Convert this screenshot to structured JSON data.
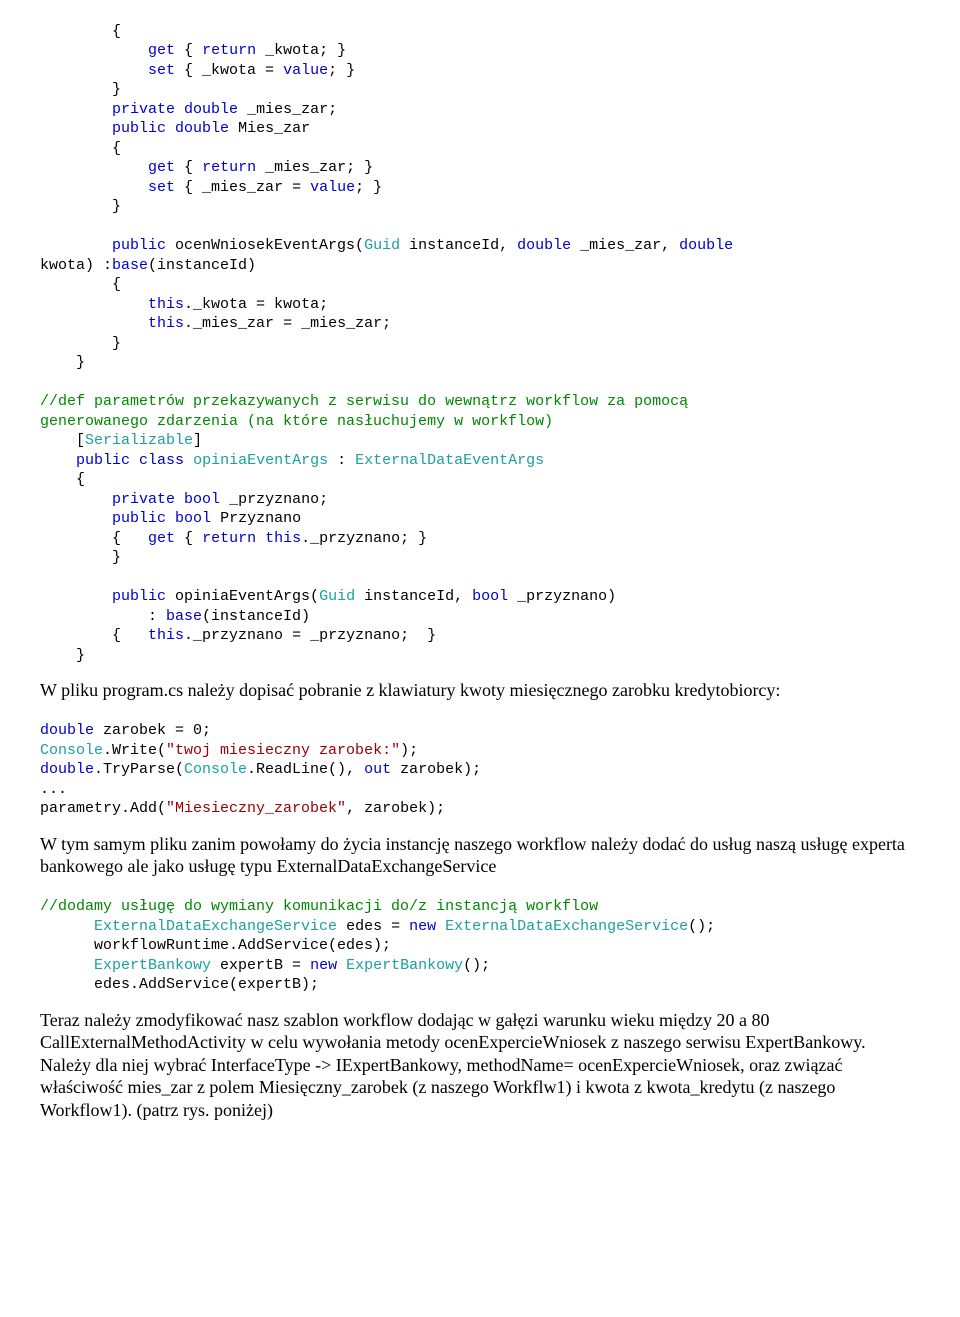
{
  "block1": {
    "l01": "        {",
    "l02a": "            ",
    "l02b": "get",
    "l02c": " { ",
    "l02d": "return",
    "l02e": " _kwota; }",
    "l03a": "            ",
    "l03b": "set",
    "l03c": " { _kwota = ",
    "l03d": "value",
    "l03e": "; }",
    "l04": "        }",
    "l05a": "        ",
    "l05b": "private",
    "l05c": " ",
    "l05d": "double",
    "l05e": " _mies_zar;",
    "l06a": "        ",
    "l06b": "public",
    "l06c": " ",
    "l06d": "double",
    "l06e": " Mies_zar",
    "l07": "        {",
    "l08a": "            ",
    "l08b": "get",
    "l08c": " { ",
    "l08d": "return",
    "l08e": " _mies_zar; }",
    "l09a": "            ",
    "l09b": "set",
    "l09c": " { _mies_zar = ",
    "l09d": "value",
    "l09e": "; }",
    "l10": "        }",
    "l11": "",
    "l12a": "        ",
    "l12b": "public",
    "l12c": " ocenWniosekEventArgs(",
    "l12d": "Guid",
    "l12e": " instanceId, ",
    "l12f": "double",
    "l12g": " _mies_zar, ",
    "l12h": "double",
    "l13a": "kwota) :",
    "l13b": "base",
    "l13c": "(instanceId)",
    "l14": "        {",
    "l15a": "            ",
    "l15b": "this",
    "l15c": "._kwota = kwota;",
    "l16a": "            ",
    "l16b": "this",
    "l16c": "._mies_zar = _mies_zar;",
    "l17": "        }",
    "l18": "    }",
    "l19": "",
    "l20": "//def parametrów przekazywanych z serwisu do wewnątrz workflow za pomocą",
    "l21": "generowanego zdarzenia (na które nasłuchujemy w workflow)",
    "l22a": "    [",
    "l22b": "Serializable",
    "l22c": "]",
    "l23a": "    ",
    "l23b": "public",
    "l23c": " ",
    "l23d": "class",
    "l23e": " ",
    "l23f": "opiniaEventArgs",
    "l23g": " : ",
    "l23h": "ExternalDataEventArgs",
    "l24": "    {",
    "l25a": "        ",
    "l25b": "private",
    "l25c": " ",
    "l25d": "bool",
    "l25e": " _przyznano;",
    "l26a": "        ",
    "l26b": "public",
    "l26c": " ",
    "l26d": "bool",
    "l26e": " Przyznano",
    "l27a": "        {   ",
    "l27b": "get",
    "l27c": " { ",
    "l27d": "return",
    "l27e": " ",
    "l27f": "this",
    "l27g": "._przyznano; }",
    "l28": "        }",
    "l29": "",
    "l30a": "        ",
    "l30b": "public",
    "l30c": " opiniaEventArgs(",
    "l30d": "Guid",
    "l30e": " instanceId, ",
    "l30f": "bool",
    "l30g": " _przyznano)",
    "l31a": "            : ",
    "l31b": "base",
    "l31c": "(instanceId)",
    "l32a": "        {   ",
    "l32b": "this",
    "l32c": "._przyznano = _przyznano;  }",
    "l33": "    }"
  },
  "prose1": "W pliku program.cs należy dopisać pobranie z klawiatury  kwoty miesięcznego zarobku kredytobiorcy:",
  "block2": {
    "l01a": "double",
    "l01b": " zarobek = 0;",
    "l02a": "Console",
    "l02b": ".Write(",
    "l02c": "\"twoj miesieczny zarobek:\"",
    "l02d": ");",
    "l03a": "double",
    "l03b": ".TryParse(",
    "l03c": "Console",
    "l03d": ".ReadLine(), ",
    "l03e": "out",
    "l03f": " zarobek);",
    "l04": "...",
    "l05a": "parametry.Add(",
    "l05b": "\"Miesieczny_zarobek\"",
    "l05c": ", zarobek);"
  },
  "prose2": "W tym samym pliku zanim powołamy do życia instancję naszego workflow należy dodać do usług naszą usługę experta bankowego ale jako usługę typu ExternalDataExchangeService",
  "block3": {
    "l01": "//dodamy usługę do wymiany komunikacji do/z instancją workflow",
    "l02a": "      ",
    "l02b": "ExternalDataExchangeService",
    "l02c": " edes = ",
    "l02d": "new",
    "l02e": " ",
    "l02f": "ExternalDataExchangeService",
    "l02g": "();",
    "l03": "      workflowRuntime.AddService(edes);",
    "l04a": "      ",
    "l04b": "ExpertBankowy",
    "l04c": " expertB = ",
    "l04d": "new",
    "l04e": " ",
    "l04f": "ExpertBankowy",
    "l04g": "();",
    "l05": "      edes.AddService(expertB);"
  },
  "prose3": "Teraz należy zmodyfikować nasz szablon workflow dodając w gałęzi warunku wieku między 20 a 80 CallExternalMethodActivity w celu wywołania metody ocenExpercieWniosek z naszego serwisu ExpertBankowy.",
  "prose4": "Należy dla niej wybrać InterfaceType -> IExpertBankowy, methodName= ocenExpercieWniosek, oraz związać właściwość mies_zar z polem Miesięczny_zarobek (z naszego Workflw1) i kwota z kwota_kredytu (z naszego Workflow1). (patrz rys. poniżej)"
}
